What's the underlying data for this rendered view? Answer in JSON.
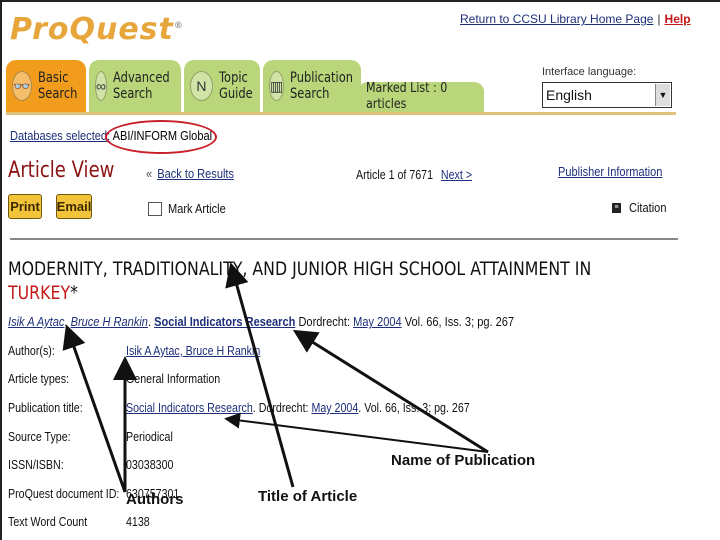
{
  "header": {
    "logo": "ProQuest",
    "logo_mark": "®",
    "return_link": "Return to CCSU Library Home Page",
    "separator": "|",
    "help_link": "Help"
  },
  "tabs": [
    {
      "line1": "Basic",
      "line2": "Search",
      "icon": "glasses-icon",
      "glyph": "👓",
      "active": true
    },
    {
      "line1": "Advanced",
      "line2": "Search",
      "icon": "knot-icon",
      "glyph": "∞",
      "active": false
    },
    {
      "line1": "Topic",
      "line2": "Guide",
      "icon": "compass-icon",
      "glyph": "N",
      "active": false
    },
    {
      "line1": "Publication",
      "line2": "Search",
      "icon": "book-icon",
      "glyph": "▥",
      "active": false
    }
  ],
  "marked_list": {
    "label": "Marked List : 0 articles"
  },
  "language": {
    "label": "Interface language:",
    "selected": "English",
    "arrow": "▼"
  },
  "databases": {
    "label": "Databases selected:",
    "value": "ABI/INFORM Global"
  },
  "article_view": {
    "heading": "Article View",
    "back_chevron": "«",
    "back_link": "Back to Results",
    "count_text": "Article 1 of 7671",
    "next_link": "Next >",
    "publisher_link": "Publisher Information",
    "print_label": "Print",
    "email_label": "Email",
    "mark_label": "Mark Article",
    "citation_label": "Citation"
  },
  "article": {
    "title_main": "MODERNITY, TRADITIONALITY, AND JUNIOR HIGH SCHOOL ATTAINMENT IN",
    "title_red": "TURKEY",
    "title_star": "*",
    "authors": [
      "Isik A Aytac",
      "Bruce H Rankin"
    ],
    "author_sep": ",",
    "publication": "Social Indicators Research",
    "place": "Dordrecht:",
    "date": "May 2004",
    "issue": "Vol. 66, Iss. 3;  pg. 267"
  },
  "fields": [
    {
      "key": "Author(s):",
      "value": "Isik A Aytac, Bruce H Rankin",
      "link": true
    },
    {
      "key": "Article types:",
      "value": "General Information",
      "link": false
    },
    {
      "key": "Publication title:",
      "value_link": "Social Indicators Research",
      "value_rest": ". Dordrecht: ",
      "value_link2": "May 2004",
      "value_tail": ". Vol. 66, Iss. 3;  pg. 267"
    },
    {
      "key": "Source Type:",
      "value": "Periodical",
      "link": false
    },
    {
      "key": "ISSN/ISBN:",
      "value": "03038300",
      "link": false
    },
    {
      "key": "ProQuest document ID:",
      "value": "630757301",
      "link": false
    },
    {
      "key": "Text Word Count",
      "value": "4138",
      "link": false
    }
  ],
  "annotations": {
    "authors": "Authors",
    "title": "Title of Article",
    "publication": "Name of Publication",
    "oval_color": "#c8202a"
  }
}
